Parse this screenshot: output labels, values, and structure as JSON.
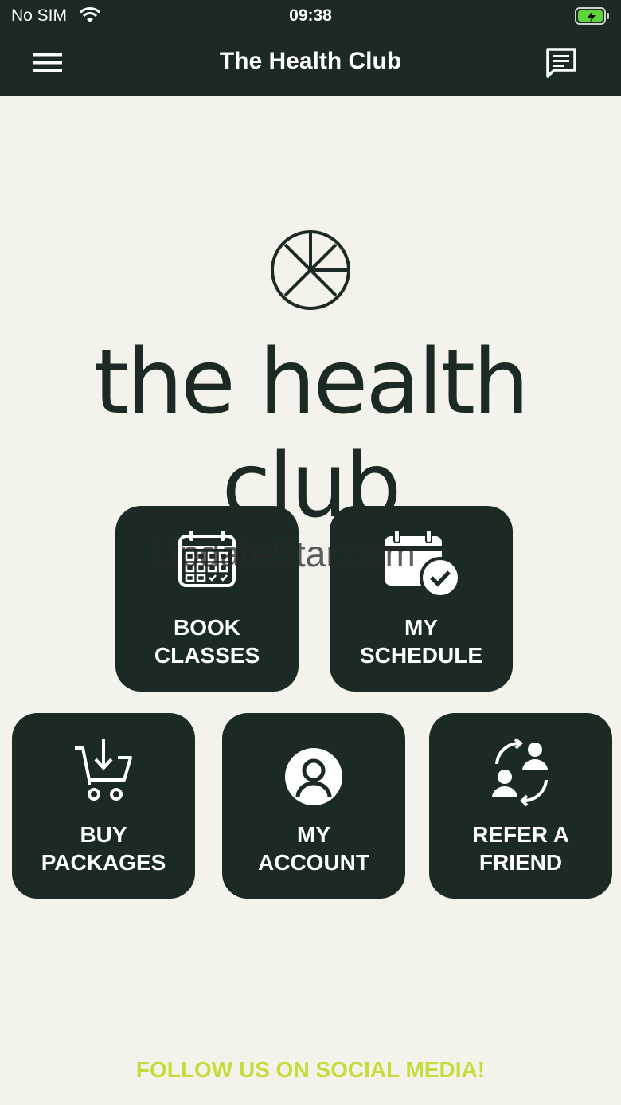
{
  "status_bar": {
    "carrier": "No SIM",
    "time": "09:38",
    "battery_icon": "battery-charging-icon",
    "wifi_icon": "wifi-icon"
  },
  "nav": {
    "title": "The Health Club",
    "menu_icon": "hamburger-menu-icon",
    "chat_icon": "chat-message-icon"
  },
  "logo": {
    "wordmark": "the health club"
  },
  "tiles": [
    {
      "label": "BOOK\nCLASSES",
      "icon": "calendar-grid-icon"
    },
    {
      "label": "MY\nSCHEDULE",
      "icon": "calendar-check-icon"
    },
    {
      "label": "BUY\nPACKAGES",
      "icon": "cart-download-icon"
    },
    {
      "label": "MY\nACCOUNT",
      "icon": "user-avatar-icon"
    },
    {
      "label": "REFER A\nFRIEND",
      "icon": "refer-friend-icon"
    }
  ],
  "watermark": "UpdateStar.com",
  "footer": {
    "follow_label": "FOLLOW US ON SOCIAL MEDIA!"
  },
  "colors": {
    "brand_dark": "#1b2a22",
    "background": "#f3f3ec",
    "accent_lime": "#c8db3a"
  }
}
